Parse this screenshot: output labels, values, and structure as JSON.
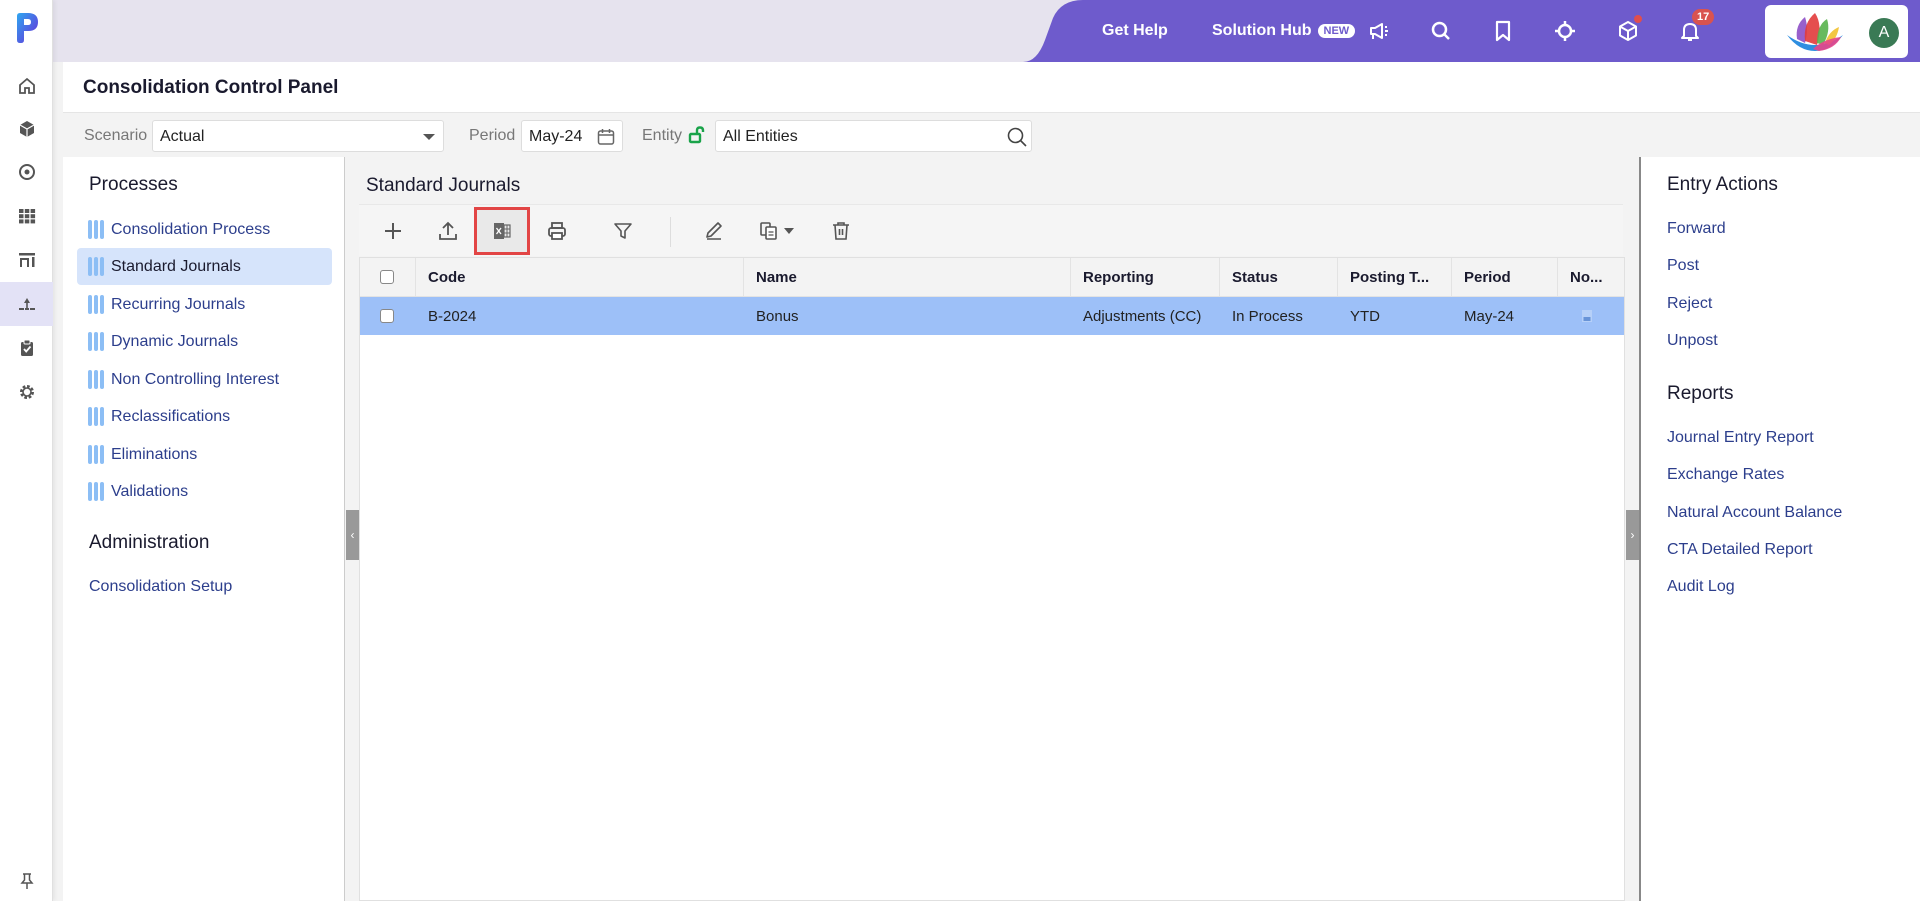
{
  "app": {
    "brand_color": "#6e5bcc",
    "accent_blue": "#9dc0f8"
  },
  "rail": {
    "items": [
      {
        "icon": "home-icon"
      },
      {
        "icon": "cube-icon"
      },
      {
        "icon": "target-icon"
      },
      {
        "icon": "grid-icon"
      },
      {
        "icon": "chart-icon"
      },
      {
        "icon": "hierarchy-icon",
        "active": true
      },
      {
        "icon": "clipboard-check-icon"
      },
      {
        "icon": "gear-icon"
      }
    ],
    "pin_icon": "pin-icon"
  },
  "topbar": {
    "get_help": "Get Help",
    "solution_hub": "Solution Hub",
    "new_badge": "NEW",
    "notification_count": "17",
    "avatar_initial": "A"
  },
  "page": {
    "title": "Consolidation Control Panel"
  },
  "filters": {
    "scenario_label": "Scenario",
    "scenario_value": "Actual",
    "period_label": "Period",
    "period_value": "May-24",
    "entity_label": "Entity",
    "entity_value": "All Entities"
  },
  "left": {
    "processes_title": "Processes",
    "processes": [
      {
        "label": "Consolidation Process"
      },
      {
        "label": "Standard Journals",
        "active": true
      },
      {
        "label": "Recurring Journals"
      },
      {
        "label": "Dynamic Journals"
      },
      {
        "label": "Non Controlling Interest"
      },
      {
        "label": "Reclassifications"
      },
      {
        "label": "Eliminations"
      },
      {
        "label": "Validations"
      }
    ],
    "admin_title": "Administration",
    "admin_items": [
      {
        "label": "Consolidation Setup"
      }
    ]
  },
  "center": {
    "title": "Standard Journals",
    "toolbar": [
      "add",
      "upload",
      "export-excel",
      "print",
      "filter",
      "edit",
      "copy",
      "delete"
    ],
    "columns": [
      "Code",
      "Name",
      "Reporting",
      "Status",
      "Posting T...",
      "Period",
      "No..."
    ],
    "rows": [
      {
        "code": "B-2024",
        "name": "Bonus",
        "reporting": "Adjustments (CC)",
        "status": "In Process",
        "posting_type": "YTD",
        "period": "May-24",
        "notes": "note-icon"
      }
    ]
  },
  "right": {
    "entry_actions_title": "Entry Actions",
    "entry_actions": [
      "Forward",
      "Post",
      "Reject",
      "Unpost"
    ],
    "reports_title": "Reports",
    "reports": [
      "Journal Entry Report",
      "Exchange Rates",
      "Natural Account Balance",
      "CTA Detailed Report",
      "Audit Log"
    ]
  }
}
